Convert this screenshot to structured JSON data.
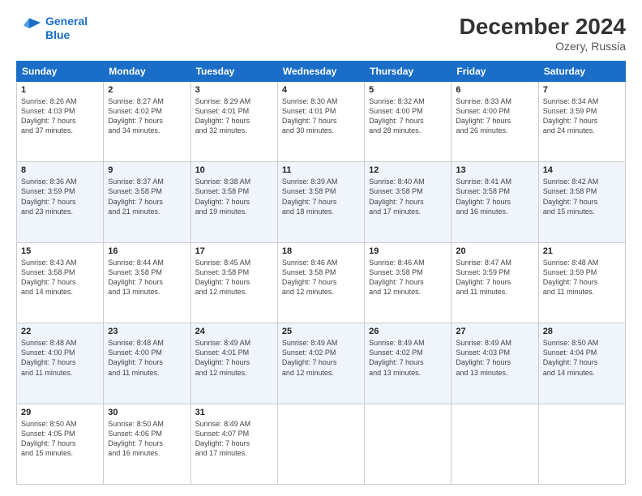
{
  "logo": {
    "line1": "General",
    "line2": "Blue"
  },
  "title": "December 2024",
  "subtitle": "Ozery, Russia",
  "header_days": [
    "Sunday",
    "Monday",
    "Tuesday",
    "Wednesday",
    "Thursday",
    "Friday",
    "Saturday"
  ],
  "weeks": [
    [
      {
        "day": "1",
        "info": "Sunrise: 8:26 AM\nSunset: 4:03 PM\nDaylight: 7 hours\nand 37 minutes."
      },
      {
        "day": "2",
        "info": "Sunrise: 8:27 AM\nSunset: 4:02 PM\nDaylight: 7 hours\nand 34 minutes."
      },
      {
        "day": "3",
        "info": "Sunrise: 8:29 AM\nSunset: 4:01 PM\nDaylight: 7 hours\nand 32 minutes."
      },
      {
        "day": "4",
        "info": "Sunrise: 8:30 AM\nSunset: 4:01 PM\nDaylight: 7 hours\nand 30 minutes."
      },
      {
        "day": "5",
        "info": "Sunrise: 8:32 AM\nSunset: 4:00 PM\nDaylight: 7 hours\nand 28 minutes."
      },
      {
        "day": "6",
        "info": "Sunrise: 8:33 AM\nSunset: 4:00 PM\nDaylight: 7 hours\nand 26 minutes."
      },
      {
        "day": "7",
        "info": "Sunrise: 8:34 AM\nSunset: 3:59 PM\nDaylight: 7 hours\nand 24 minutes."
      }
    ],
    [
      {
        "day": "8",
        "info": "Sunrise: 8:36 AM\nSunset: 3:59 PM\nDaylight: 7 hours\nand 23 minutes."
      },
      {
        "day": "9",
        "info": "Sunrise: 8:37 AM\nSunset: 3:58 PM\nDaylight: 7 hours\nand 21 minutes."
      },
      {
        "day": "10",
        "info": "Sunrise: 8:38 AM\nSunset: 3:58 PM\nDaylight: 7 hours\nand 19 minutes."
      },
      {
        "day": "11",
        "info": "Sunrise: 8:39 AM\nSunset: 3:58 PM\nDaylight: 7 hours\nand 18 minutes."
      },
      {
        "day": "12",
        "info": "Sunrise: 8:40 AM\nSunset: 3:58 PM\nDaylight: 7 hours\nand 17 minutes."
      },
      {
        "day": "13",
        "info": "Sunrise: 8:41 AM\nSunset: 3:58 PM\nDaylight: 7 hours\nand 16 minutes."
      },
      {
        "day": "14",
        "info": "Sunrise: 8:42 AM\nSunset: 3:58 PM\nDaylight: 7 hours\nand 15 minutes."
      }
    ],
    [
      {
        "day": "15",
        "info": "Sunrise: 8:43 AM\nSunset: 3:58 PM\nDaylight: 7 hours\nand 14 minutes."
      },
      {
        "day": "16",
        "info": "Sunrise: 8:44 AM\nSunset: 3:58 PM\nDaylight: 7 hours\nand 13 minutes."
      },
      {
        "day": "17",
        "info": "Sunrise: 8:45 AM\nSunset: 3:58 PM\nDaylight: 7 hours\nand 12 minutes."
      },
      {
        "day": "18",
        "info": "Sunrise: 8:46 AM\nSunset: 3:58 PM\nDaylight: 7 hours\nand 12 minutes."
      },
      {
        "day": "19",
        "info": "Sunrise: 8:46 AM\nSunset: 3:58 PM\nDaylight: 7 hours\nand 12 minutes."
      },
      {
        "day": "20",
        "info": "Sunrise: 8:47 AM\nSunset: 3:59 PM\nDaylight: 7 hours\nand 11 minutes."
      },
      {
        "day": "21",
        "info": "Sunrise: 8:48 AM\nSunset: 3:59 PM\nDaylight: 7 hours\nand 11 minutes."
      }
    ],
    [
      {
        "day": "22",
        "info": "Sunrise: 8:48 AM\nSunset: 4:00 PM\nDaylight: 7 hours\nand 11 minutes."
      },
      {
        "day": "23",
        "info": "Sunrise: 8:48 AM\nSunset: 4:00 PM\nDaylight: 7 hours\nand 11 minutes."
      },
      {
        "day": "24",
        "info": "Sunrise: 8:49 AM\nSunset: 4:01 PM\nDaylight: 7 hours\nand 12 minutes."
      },
      {
        "day": "25",
        "info": "Sunrise: 8:49 AM\nSunset: 4:02 PM\nDaylight: 7 hours\nand 12 minutes."
      },
      {
        "day": "26",
        "info": "Sunrise: 8:49 AM\nSunset: 4:02 PM\nDaylight: 7 hours\nand 13 minutes."
      },
      {
        "day": "27",
        "info": "Sunrise: 8:49 AM\nSunset: 4:03 PM\nDaylight: 7 hours\nand 13 minutes."
      },
      {
        "day": "28",
        "info": "Sunrise: 8:50 AM\nSunset: 4:04 PM\nDaylight: 7 hours\nand 14 minutes."
      }
    ],
    [
      {
        "day": "29",
        "info": "Sunrise: 8:50 AM\nSunset: 4:05 PM\nDaylight: 7 hours\nand 15 minutes."
      },
      {
        "day": "30",
        "info": "Sunrise: 8:50 AM\nSunset: 4:06 PM\nDaylight: 7 hours\nand 16 minutes."
      },
      {
        "day": "31",
        "info": "Sunrise: 8:49 AM\nSunset: 4:07 PM\nDaylight: 7 hours\nand 17 minutes."
      },
      {
        "day": "",
        "info": ""
      },
      {
        "day": "",
        "info": ""
      },
      {
        "day": "",
        "info": ""
      },
      {
        "day": "",
        "info": ""
      }
    ]
  ]
}
